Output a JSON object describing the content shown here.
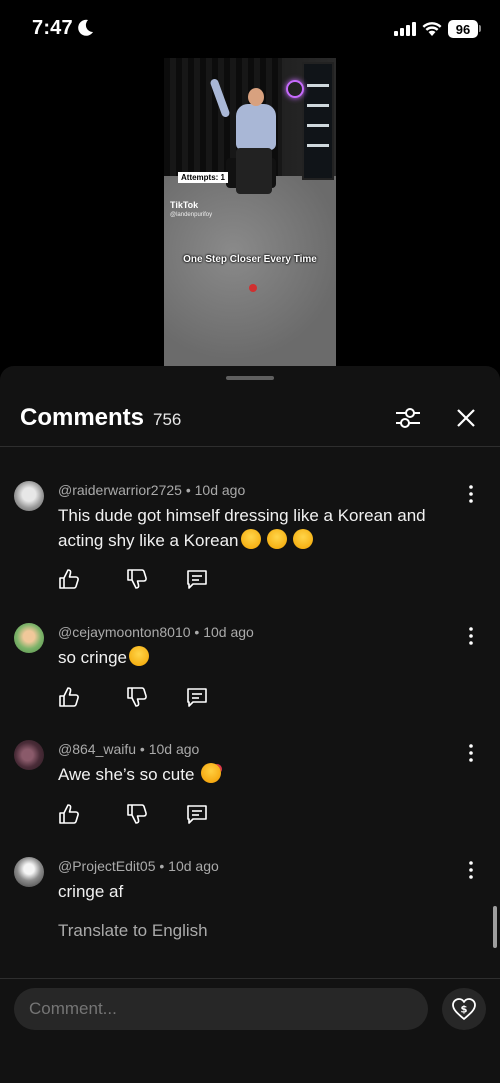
{
  "status_bar": {
    "time": "7:47",
    "battery": "96"
  },
  "video": {
    "attempts_label": "Attempts: 1",
    "watermark": "TikTok",
    "watermark_user": "@landenpurifoy",
    "caption": "One Step Closer Every Time"
  },
  "comments_panel": {
    "title": "Comments",
    "count": "756",
    "comments": [
      {
        "author": "@raiderwarrior2725",
        "age": "10d ago",
        "text": "This dude got himself dressing like a Korean and acting shy like a Korean",
        "emoji": [
          "rofl",
          "rofl",
          "rofl"
        ]
      },
      {
        "author": "@cejaymoonton8010",
        "age": "10d ago",
        "text": "so cringe",
        "emoji": [
          "grimacing"
        ]
      },
      {
        "author": "@864_waifu",
        "age": "10d ago",
        "text": "Awe she’s so cute",
        "emoji": [
          "smiling-face-with-hearts"
        ]
      },
      {
        "author": "@ProjectEdit05",
        "age": "10d ago",
        "text": "cringe af",
        "translate_label": "Translate to English"
      }
    ],
    "input_placeholder": "Comment...",
    "meta_separator": " • "
  },
  "colors": {
    "sheet_bg": "#121212",
    "input_bg": "#272727",
    "meta_text": "#aaaaaa"
  }
}
